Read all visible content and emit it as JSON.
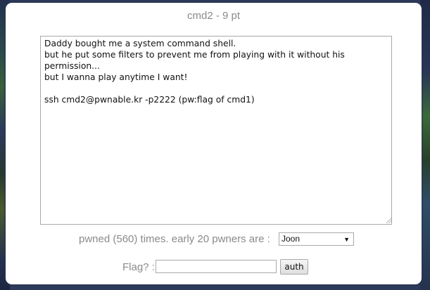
{
  "dialog": {
    "title": "cmd2 - 9 pt",
    "description": "Daddy bought me a system command shell.\nbut he put some filters to prevent me from playing with it without his permission...\nbut I wanna play anytime I want!\n\nssh cmd2@pwnable.kr -p2222 (pw:flag of cmd1)",
    "pwned_text": "pwned (560) times. early 20 pwners are :",
    "pwners_selected": "Joon",
    "flag_label": "Flag? :",
    "flag_value": "",
    "auth_label": "auth"
  }
}
